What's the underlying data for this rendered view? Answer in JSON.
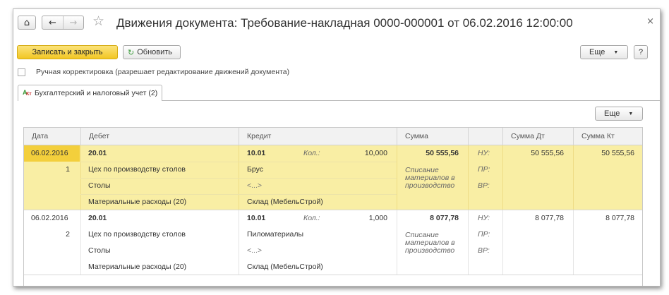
{
  "window": {
    "title": "Движения документа: Требование-накладная 0000-000001 от 06.02.2016 12:00:00",
    "close_glyph": "×"
  },
  "nav": {
    "home_glyph": "⌂",
    "back_glyph": "←",
    "forward_glyph": "→",
    "favorite_glyph": "☆"
  },
  "toolbar": {
    "save_close_label": "Записать и закрыть",
    "refresh_label": "Обновить",
    "refresh_glyph": "↻",
    "more_label": "Еще",
    "help_label": "?"
  },
  "manual_adjust": {
    "checked": false,
    "label": "Ручная корректировка (разрешает редактирование движений документа)"
  },
  "tabs": [
    {
      "label": "Бухгалтерский и налоговый учет (2)",
      "active": true
    }
  ],
  "grid": {
    "more_label": "Еще",
    "columns": {
      "date": "Дата",
      "debit": "Дебет",
      "credit": "Кредит",
      "sum": "Сумма",
      "type": "",
      "sum_dt": "Сумма Дт",
      "sum_kt": "Сумма Кт"
    },
    "records": [
      {
        "selected": true,
        "date": "06.02.2016",
        "num": "1",
        "debit_account": "20.01",
        "debit_sub": [
          "Цех по производству столов",
          "Столы",
          "Материальные расходы (20)"
        ],
        "credit_account": "10.01",
        "qty_label": "Кол.:",
        "qty": "10,000",
        "credit_sub": [
          "Брус",
          "<...>",
          "Склад (МебельСтрой)"
        ],
        "sum": "50 555,56",
        "content": "Списание материалов в производство",
        "types": [
          "НУ:",
          "ПР:",
          "ВР:"
        ],
        "sum_dt": "50 555,56",
        "sum_kt": "50 555,56"
      },
      {
        "selected": false,
        "date": "06.02.2016",
        "num": "2",
        "debit_account": "20.01",
        "debit_sub": [
          "Цех по производству столов",
          "Столы",
          "Материальные расходы (20)"
        ],
        "credit_account": "10.01",
        "qty_label": "Кол.:",
        "qty": "1,000",
        "credit_sub": [
          "Пиломатериалы",
          "<...>",
          "Склад (МебельСтрой)"
        ],
        "sum": "8 077,78",
        "content": "Списание материалов в производство",
        "types": [
          "НУ:",
          "ПР:",
          "ВР:"
        ],
        "sum_dt": "8 077,78",
        "sum_kt": "8 077,78"
      }
    ]
  },
  "colors": {
    "accent_yellow": "#f2c624",
    "selected_row": "#f9eea4",
    "selected_date": "#f3cf3c"
  }
}
